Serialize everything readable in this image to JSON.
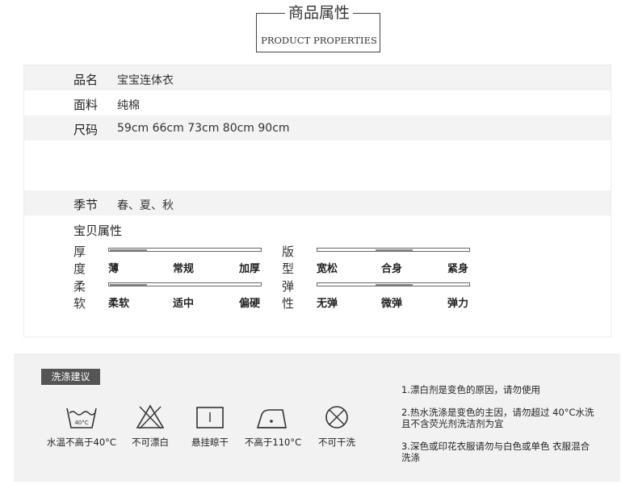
{
  "header": {
    "title": "商品属性",
    "subtitle": "PRODUCT PROPERTIES"
  },
  "props": [
    {
      "key": "品名",
      "value": "宝宝连体衣"
    },
    {
      "key": "面料",
      "value": "纯棉"
    },
    {
      "key": "尺码",
      "value": "59cm 66cm 73cm 80cm 90cm"
    },
    {
      "key": "季节",
      "value": "春、夏、秋"
    }
  ],
  "attributes": {
    "title": "宝贝属性",
    "sliders": [
      {
        "label": "厚度",
        "ticks": [
          "薄",
          "常规",
          "加厚"
        ],
        "selected_index": 0
      },
      {
        "label": "版型",
        "ticks": [
          "宽松",
          "合身",
          "紧身"
        ],
        "selected_index": 1
      },
      {
        "label": "柔软",
        "ticks": [
          "柔软",
          "适中",
          "偏硬"
        ],
        "selected_index": 0
      },
      {
        "label": "弹性",
        "ticks": [
          "无弹",
          "微弹",
          "弹力"
        ],
        "selected_index": 1
      }
    ]
  },
  "wash": {
    "title": "洗涤建议",
    "icons": [
      {
        "icon": "wash-40-icon",
        "caption": "水温不高于40°C",
        "badge": "40°C"
      },
      {
        "icon": "no-bleach-icon",
        "caption": "不可漂白"
      },
      {
        "icon": "hang-dry-icon",
        "caption": "悬挂晾干"
      },
      {
        "icon": "iron-icon",
        "caption": "不高于110°C"
      },
      {
        "icon": "no-dry-clean-icon",
        "caption": "不可干洗"
      }
    ],
    "notes": [
      "1.漂白剂是变色的原因，请勿使用",
      "2.热水洗涤是变色的主因，请勿超过 40°C水洗且不含荧光剂洗洁剂为宜",
      "3.深色或印花衣服请勿与白色或单色 衣服混合洗涤"
    ]
  }
}
